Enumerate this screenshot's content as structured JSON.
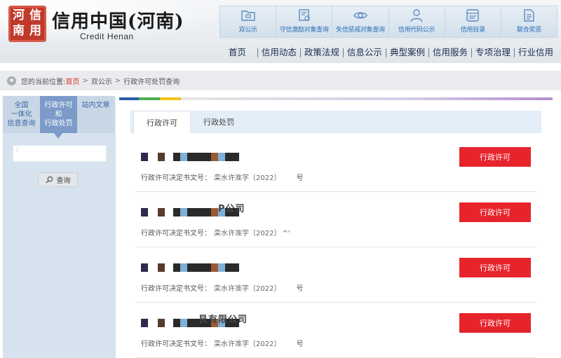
{
  "header": {
    "logo_seal_chars": [
      "信",
      "用",
      "河",
      "南"
    ],
    "title": "信用中国(河南)",
    "subtitle": "Credit Henan",
    "quick_links": [
      {
        "label": "双公示",
        "icon": "folder-icon"
      },
      {
        "label": "守信激励对象查询",
        "icon": "certificate-icon"
      },
      {
        "label": "失信惩戒对象查询",
        "icon": "eye-icon"
      },
      {
        "label": "信用代码公示",
        "icon": "user-icon"
      },
      {
        "label": "信用目录",
        "icon": "catalog-icon"
      },
      {
        "label": "联合奖惩",
        "icon": "document-icon"
      }
    ],
    "nav": [
      "首页",
      "信用动态",
      "政策法规",
      "信息公示",
      "典型案例",
      "信用服务",
      "专项治理",
      "行业信用"
    ]
  },
  "breadcrumb": {
    "prefix": "您的当前位置:",
    "home": "首页",
    "sep": ">",
    "level1": "双公示",
    "level2": "行政许可处罚查询"
  },
  "sidebar": {
    "tabs": [
      {
        "label": "全国一体化信息查询",
        "lines": [
          "全国",
          "一体化",
          "信息查询"
        ]
      },
      {
        "label": "行政许可和行政处罚",
        "lines": [
          "行政许可",
          "和",
          "行政处罚"
        ],
        "active": true
      },
      {
        "label": "站内文章",
        "lines": [
          "站内文章"
        ]
      }
    ],
    "search_value": ":",
    "search_button": "查询"
  },
  "content": {
    "tabs": [
      {
        "label": "行政许可",
        "active": true
      },
      {
        "label": "行政处罚",
        "active": false
      }
    ],
    "items": [
      {
        "overlay": "",
        "meta_label": "行政许可决定书文号：",
        "meta_value": "栾水许准字〔2022〕",
        "meta_suffix": "号",
        "badge": "行政许可"
      },
      {
        "overlay": "P公司",
        "meta_label": "行政许可决定书文号：",
        "meta_value": "栾水许准字〔2022〕",
        "meta_suffix": "^'",
        "badge": "行政许可"
      },
      {
        "overlay": "",
        "meta_label": "行政许可决定书文号：",
        "meta_value": "栾水许准字〔2022〕",
        "meta_suffix": "号",
        "badge": "行政许可"
      },
      {
        "overlay": "艮有限公司",
        "meta_label": "行政许可决定书文号：",
        "meta_value": "栾水许准字〔2022〕",
        "meta_suffix": "号",
        "badge": "行政许可"
      }
    ]
  },
  "colors": {
    "accent_red": "#e7232b",
    "nav_text": "#1b2c4d",
    "link_blue": "#2b6cb5",
    "sidebar_active": "#7c9bc8",
    "redaction_palette": [
      "#2e2a4f",
      "#5a3a2e",
      "#2a2a2a",
      "#7fb0d9",
      "#9b5a33"
    ]
  }
}
